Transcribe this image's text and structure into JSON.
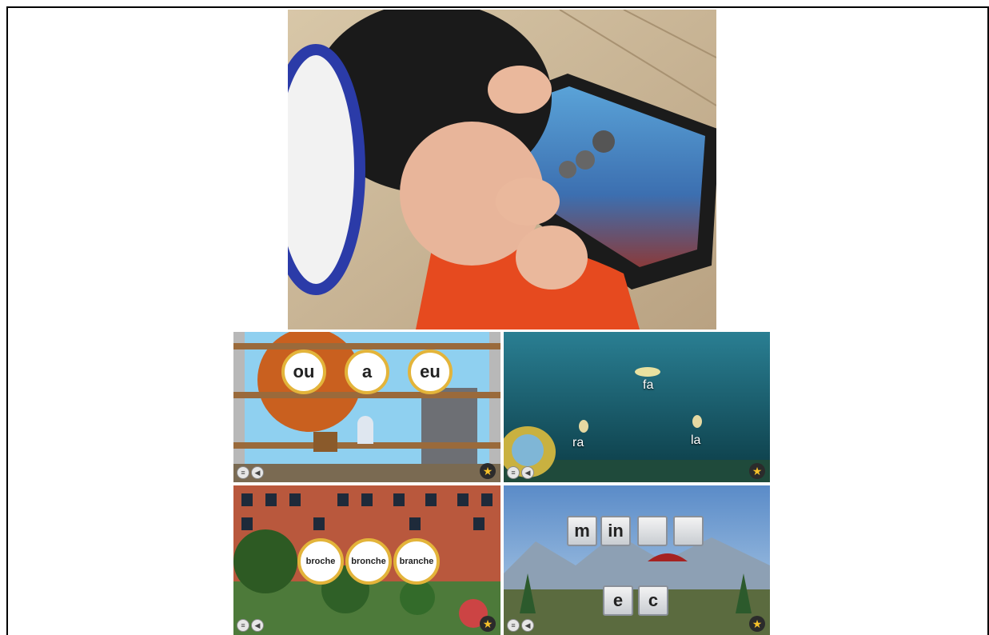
{
  "photo": {
    "screen_caption": "child playing reading game on tablet"
  },
  "panels": {
    "p1": {
      "syllables": [
        "ou",
        "a",
        "eu"
      ]
    },
    "p2": {
      "syllables": [
        "fa",
        "ra",
        "la"
      ]
    },
    "p3": {
      "words": [
        "broche",
        "bronche",
        "branche"
      ]
    },
    "p4": {
      "top_tiles": [
        "m",
        "in",
        "",
        ""
      ],
      "bottom_tiles": [
        "e",
        "c"
      ]
    }
  },
  "icons": {
    "menu": "menu-icon",
    "sound": "speaker-icon",
    "reward": "star-icon"
  }
}
